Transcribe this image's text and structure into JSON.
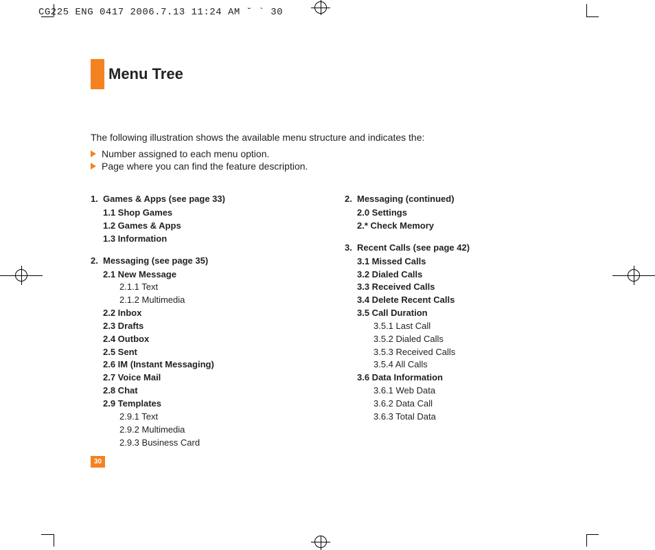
{
  "header": "CG225 ENG 0417  2006.7.13 11:24 AM  ˘   ` 30",
  "title": "Menu Tree",
  "intro": "The following illustration shows the available menu structure and indicates the:",
  "bullets": [
    "Number assigned to each menu option.",
    "Page where you can find the feature description."
  ],
  "col1": {
    "sec1": {
      "head": "Games & Apps (see page 33)",
      "items": [
        "1.1 Shop Games",
        "1.2 Games & Apps",
        "1.3 Information"
      ]
    },
    "sec2": {
      "head": "Messaging (see page 35)",
      "i21": "2.1 New Message",
      "i211": "2.1.1 Text",
      "i212": "2.1.2 Multimedia",
      "i22": "2.2 Inbox",
      "i23": "2.3 Drafts",
      "i24": "2.4 Outbox",
      "i25": "2.5 Sent",
      "i26": "2.6 IM (Instant Messaging)",
      "i27": "2.7 Voice Mail",
      "i28": "2.8 Chat",
      "i29": "2.9 Templates",
      "i291": "2.9.1 Text",
      "i292": "2.9.2 Multimedia",
      "i293": "2.9.3 Business Card"
    }
  },
  "col2": {
    "sec2c": {
      "head": "Messaging (continued)",
      "i20": "2.0 Settings",
      "i2s": "2.* Check Memory"
    },
    "sec3": {
      "head": "Recent Calls (see page 42)",
      "i31": "3.1 Missed Calls",
      "i32": "3.2 Dialed Calls",
      "i33": "3.3 Received Calls",
      "i34": "3.4 Delete Recent Calls",
      "i35": "3.5 Call Duration",
      "i351": "3.5.1 Last Call",
      "i352": "3.5.2 Dialed Calls",
      "i353": "3.5.3 Received Calls",
      "i354": "3.5.4 All Calls",
      "i36": "3.6 Data Information",
      "i361": "3.6.1 Web Data",
      "i362": "3.6.2 Data Call",
      "i363": "3.6.3 Total Data"
    }
  },
  "sectionNumbers": {
    "s1": "1.",
    "s2": "2.",
    "s2c": "2.",
    "s3": "3."
  },
  "pageNumber": "30"
}
